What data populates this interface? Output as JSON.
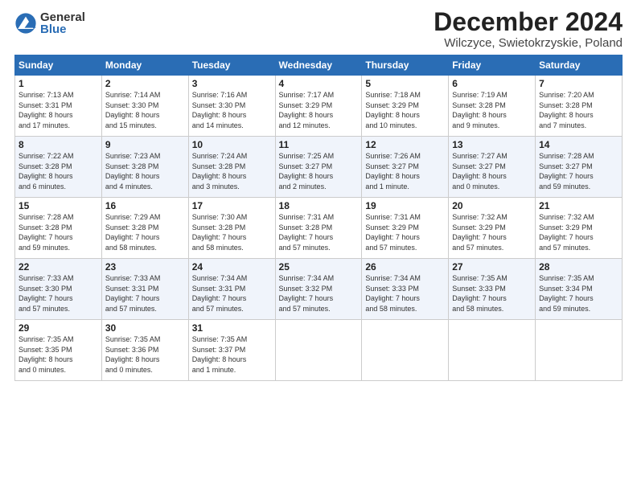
{
  "header": {
    "logo_general": "General",
    "logo_blue": "Blue",
    "month": "December 2024",
    "location": "Wilczyce, Swietokrzyskie, Poland"
  },
  "days_of_week": [
    "Sunday",
    "Monday",
    "Tuesday",
    "Wednesday",
    "Thursday",
    "Friday",
    "Saturday"
  ],
  "weeks": [
    [
      {
        "day": "1",
        "info": "Sunrise: 7:13 AM\nSunset: 3:31 PM\nDaylight: 8 hours\nand 17 minutes."
      },
      {
        "day": "2",
        "info": "Sunrise: 7:14 AM\nSunset: 3:30 PM\nDaylight: 8 hours\nand 15 minutes."
      },
      {
        "day": "3",
        "info": "Sunrise: 7:16 AM\nSunset: 3:30 PM\nDaylight: 8 hours\nand 14 minutes."
      },
      {
        "day": "4",
        "info": "Sunrise: 7:17 AM\nSunset: 3:29 PM\nDaylight: 8 hours\nand 12 minutes."
      },
      {
        "day": "5",
        "info": "Sunrise: 7:18 AM\nSunset: 3:29 PM\nDaylight: 8 hours\nand 10 minutes."
      },
      {
        "day": "6",
        "info": "Sunrise: 7:19 AM\nSunset: 3:28 PM\nDaylight: 8 hours\nand 9 minutes."
      },
      {
        "day": "7",
        "info": "Sunrise: 7:20 AM\nSunset: 3:28 PM\nDaylight: 8 hours\nand 7 minutes."
      }
    ],
    [
      {
        "day": "8",
        "info": "Sunrise: 7:22 AM\nSunset: 3:28 PM\nDaylight: 8 hours\nand 6 minutes."
      },
      {
        "day": "9",
        "info": "Sunrise: 7:23 AM\nSunset: 3:28 PM\nDaylight: 8 hours\nand 4 minutes."
      },
      {
        "day": "10",
        "info": "Sunrise: 7:24 AM\nSunset: 3:28 PM\nDaylight: 8 hours\nand 3 minutes."
      },
      {
        "day": "11",
        "info": "Sunrise: 7:25 AM\nSunset: 3:27 PM\nDaylight: 8 hours\nand 2 minutes."
      },
      {
        "day": "12",
        "info": "Sunrise: 7:26 AM\nSunset: 3:27 PM\nDaylight: 8 hours\nand 1 minute."
      },
      {
        "day": "13",
        "info": "Sunrise: 7:27 AM\nSunset: 3:27 PM\nDaylight: 8 hours\nand 0 minutes."
      },
      {
        "day": "14",
        "info": "Sunrise: 7:28 AM\nSunset: 3:27 PM\nDaylight: 7 hours\nand 59 minutes."
      }
    ],
    [
      {
        "day": "15",
        "info": "Sunrise: 7:28 AM\nSunset: 3:28 PM\nDaylight: 7 hours\nand 59 minutes."
      },
      {
        "day": "16",
        "info": "Sunrise: 7:29 AM\nSunset: 3:28 PM\nDaylight: 7 hours\nand 58 minutes."
      },
      {
        "day": "17",
        "info": "Sunrise: 7:30 AM\nSunset: 3:28 PM\nDaylight: 7 hours\nand 58 minutes."
      },
      {
        "day": "18",
        "info": "Sunrise: 7:31 AM\nSunset: 3:28 PM\nDaylight: 7 hours\nand 57 minutes."
      },
      {
        "day": "19",
        "info": "Sunrise: 7:31 AM\nSunset: 3:29 PM\nDaylight: 7 hours\nand 57 minutes."
      },
      {
        "day": "20",
        "info": "Sunrise: 7:32 AM\nSunset: 3:29 PM\nDaylight: 7 hours\nand 57 minutes."
      },
      {
        "day": "21",
        "info": "Sunrise: 7:32 AM\nSunset: 3:29 PM\nDaylight: 7 hours\nand 57 minutes."
      }
    ],
    [
      {
        "day": "22",
        "info": "Sunrise: 7:33 AM\nSunset: 3:30 PM\nDaylight: 7 hours\nand 57 minutes."
      },
      {
        "day": "23",
        "info": "Sunrise: 7:33 AM\nSunset: 3:31 PM\nDaylight: 7 hours\nand 57 minutes."
      },
      {
        "day": "24",
        "info": "Sunrise: 7:34 AM\nSunset: 3:31 PM\nDaylight: 7 hours\nand 57 minutes."
      },
      {
        "day": "25",
        "info": "Sunrise: 7:34 AM\nSunset: 3:32 PM\nDaylight: 7 hours\nand 57 minutes."
      },
      {
        "day": "26",
        "info": "Sunrise: 7:34 AM\nSunset: 3:33 PM\nDaylight: 7 hours\nand 58 minutes."
      },
      {
        "day": "27",
        "info": "Sunrise: 7:35 AM\nSunset: 3:33 PM\nDaylight: 7 hours\nand 58 minutes."
      },
      {
        "day": "28",
        "info": "Sunrise: 7:35 AM\nSunset: 3:34 PM\nDaylight: 7 hours\nand 59 minutes."
      }
    ],
    [
      {
        "day": "29",
        "info": "Sunrise: 7:35 AM\nSunset: 3:35 PM\nDaylight: 8 hours\nand 0 minutes."
      },
      {
        "day": "30",
        "info": "Sunrise: 7:35 AM\nSunset: 3:36 PM\nDaylight: 8 hours\nand 0 minutes."
      },
      {
        "day": "31",
        "info": "Sunrise: 7:35 AM\nSunset: 3:37 PM\nDaylight: 8 hours\nand 1 minute."
      },
      null,
      null,
      null,
      null
    ]
  ]
}
